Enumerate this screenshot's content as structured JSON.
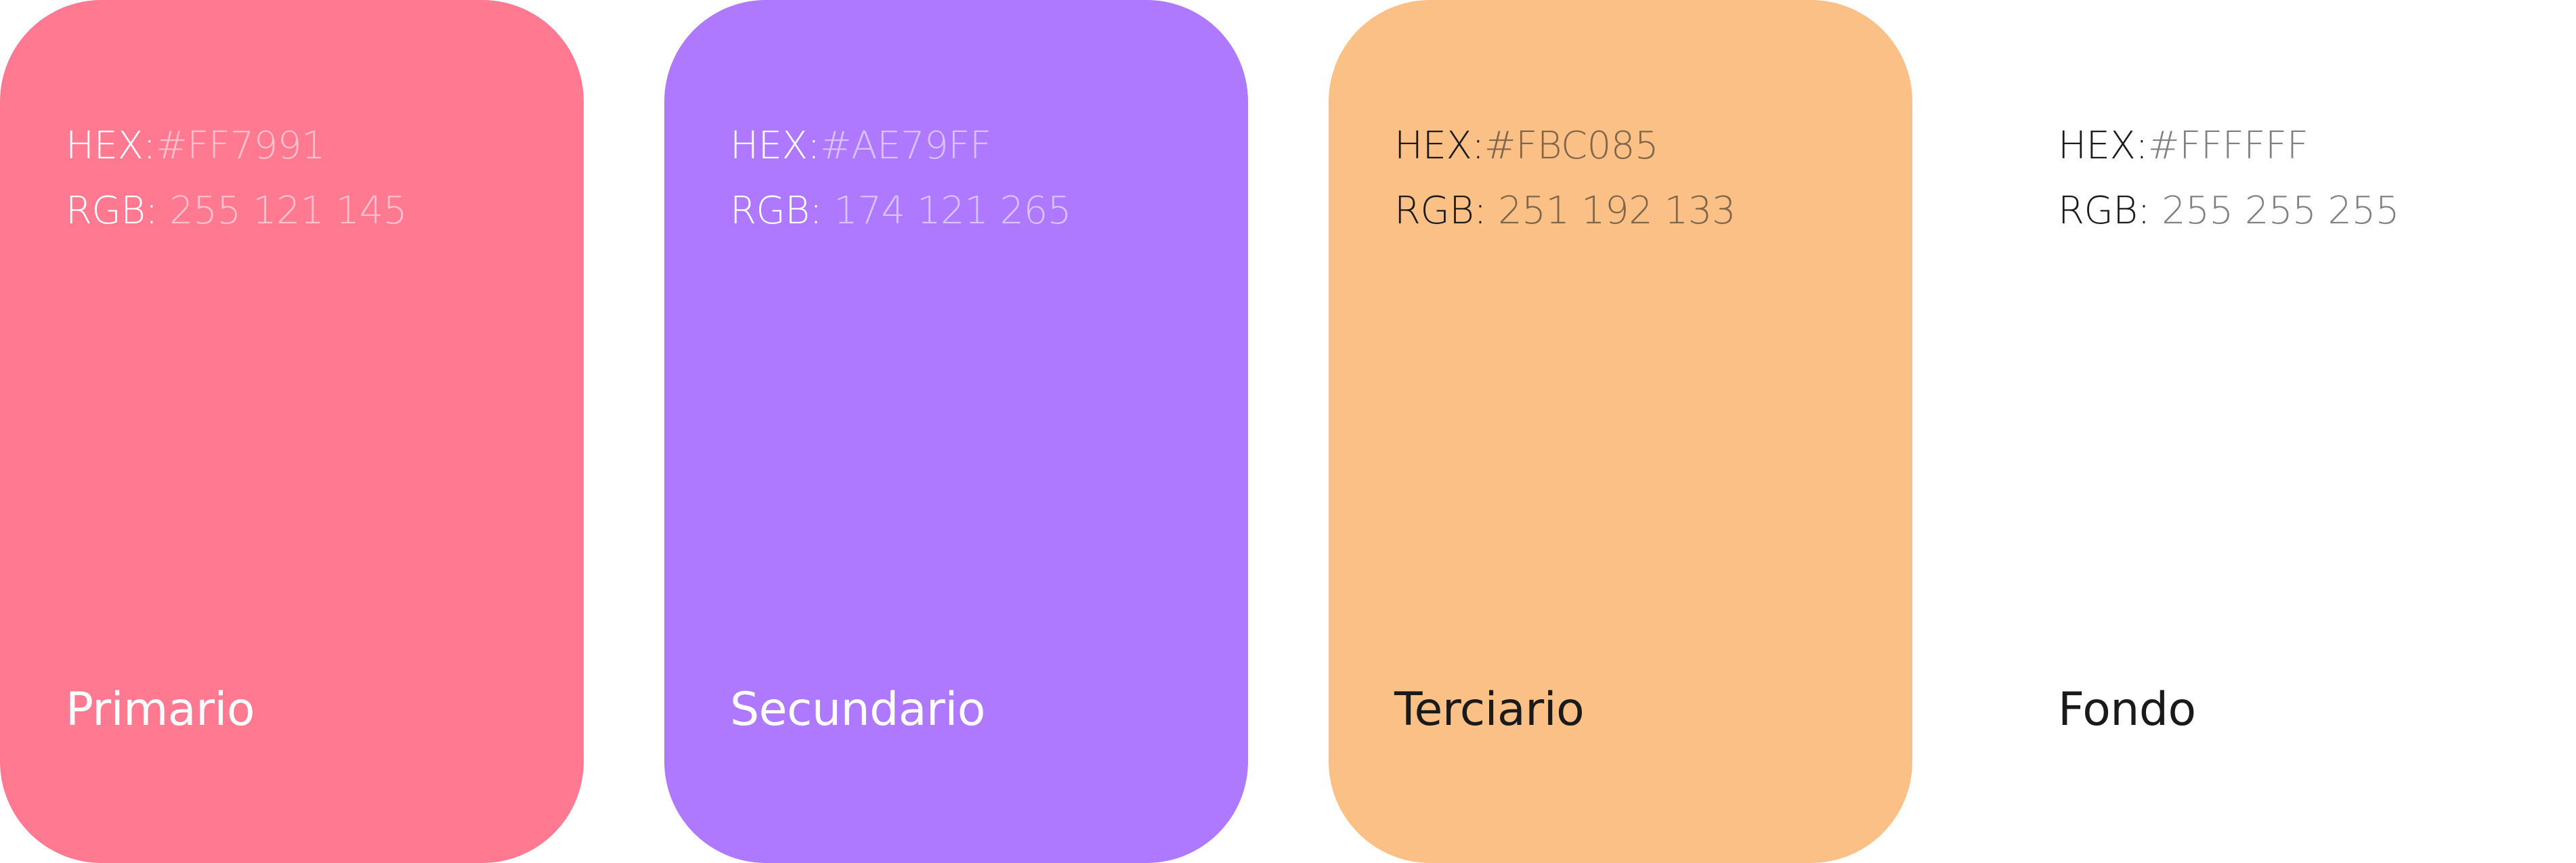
{
  "swatches": [
    {
      "id": "primario",
      "name": "Primario",
      "color": "#FF7991",
      "theme": "light",
      "hex_label": "HEX:",
      "hex_value": "#FF7991",
      "rgb_label": "RGB:",
      "rgb_value": " 255 121 145"
    },
    {
      "id": "secundario",
      "name": "Secundario",
      "color": "#AE79FF",
      "theme": "light",
      "hex_label": "HEX:",
      "hex_value": "#AE79FF",
      "rgb_label": "RGB:",
      "rgb_value": " 174 121 265"
    },
    {
      "id": "terciario",
      "name": "Terciario",
      "color": "#FBC085",
      "theme": "dark",
      "hex_label": "HEX:",
      "hex_value": "#FBC085",
      "rgb_label": "RGB:",
      "rgb_value": " 251 192 133"
    },
    {
      "id": "fondo",
      "name": "Fondo",
      "color": "#FFFFFF",
      "theme": "dark",
      "hex_label": "HEX:",
      "hex_value": "#FFFFFF",
      "rgb_label": "RGB:",
      "rgb_value": " 255 255 255"
    }
  ]
}
